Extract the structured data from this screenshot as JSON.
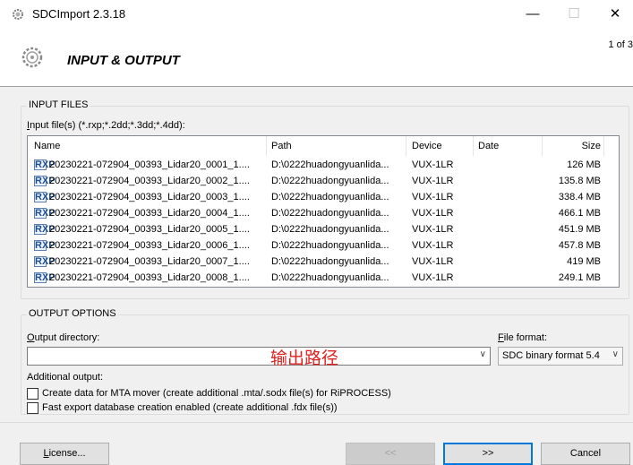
{
  "window": {
    "title": "SDCImport 2.3.18",
    "minimize": "—",
    "maximize": "☐",
    "close": "✕"
  },
  "header": {
    "title": "INPUT & OUTPUT",
    "page_indicator": "1 of 3"
  },
  "input_files": {
    "group_title": "INPUT FILES",
    "list_label_prefix": "I",
    "list_label_rest": "nput file(s) (*.rxp;*.2dd;*.3dd;*.4dd):",
    "columns": [
      "Name",
      "Path",
      "Device",
      "Date",
      "Size"
    ],
    "icon_label": "RXP",
    "rows": [
      {
        "name": "20230221-072904_00393_Lidar20_0001_1....",
        "path": "D:\\0222huadongyuanlida...",
        "device": "VUX-1LR",
        "date": "",
        "size": "126 MB"
      },
      {
        "name": "20230221-072904_00393_Lidar20_0002_1....",
        "path": "D:\\0222huadongyuanlida...",
        "device": "VUX-1LR",
        "date": "",
        "size": "135.8 MB"
      },
      {
        "name": "20230221-072904_00393_Lidar20_0003_1....",
        "path": "D:\\0222huadongyuanlida...",
        "device": "VUX-1LR",
        "date": "",
        "size": "338.4 MB"
      },
      {
        "name": "20230221-072904_00393_Lidar20_0004_1....",
        "path": "D:\\0222huadongyuanlida...",
        "device": "VUX-1LR",
        "date": "",
        "size": "466.1 MB"
      },
      {
        "name": "20230221-072904_00393_Lidar20_0005_1....",
        "path": "D:\\0222huadongyuanlida...",
        "device": "VUX-1LR",
        "date": "",
        "size": "451.9 MB"
      },
      {
        "name": "20230221-072904_00393_Lidar20_0006_1....",
        "path": "D:\\0222huadongyuanlida...",
        "device": "VUX-1LR",
        "date": "",
        "size": "457.8 MB"
      },
      {
        "name": "20230221-072904_00393_Lidar20_0007_1....",
        "path": "D:\\0222huadongyuanlida...",
        "device": "VUX-1LR",
        "date": "",
        "size": "419 MB"
      },
      {
        "name": "20230221-072904_00393_Lidar20_0008_1....",
        "path": "D:\\0222huadongyuanlida...",
        "device": "VUX-1LR",
        "date": "",
        "size": "249.1 MB"
      }
    ]
  },
  "output_options": {
    "group_title": "OUTPUT OPTIONS",
    "dir_label_prefix": "O",
    "dir_label_rest": "utput directory:",
    "dir_value": "",
    "dir_annotation": "输出路径",
    "format_label_prefix": "F",
    "format_label_rest": "ile format:",
    "format_value": "SDC binary format 5.4",
    "dropdown_arrow": "∨",
    "additional_label": "Additional output:",
    "checkbox_mta": "Create data for MTA mover (create additional .mta/.sodx file(s) for RiPROCESS)",
    "checkbox_fdx": "Fast export database creation enabled (create additional .fdx file(s))",
    "checkbox_mta_checked": false,
    "checkbox_fdx_checked": false
  },
  "footer": {
    "license_prefix": "L",
    "license_rest": "icense...",
    "back": "<<",
    "next": ">>",
    "cancel": "Cancel"
  }
}
